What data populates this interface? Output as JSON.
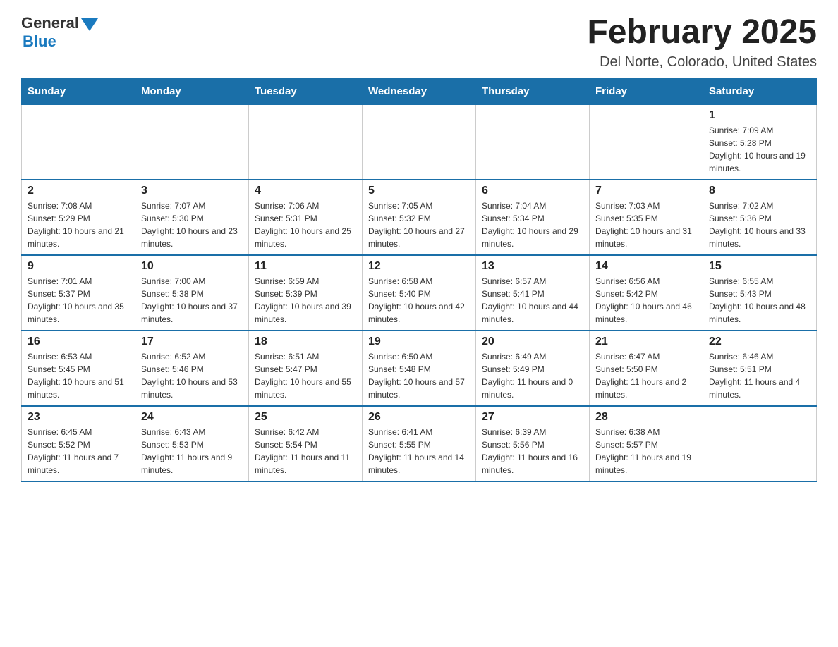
{
  "header": {
    "logo_general": "General",
    "logo_blue": "Blue",
    "title": "February 2025",
    "subtitle": "Del Norte, Colorado, United States"
  },
  "days_of_week": [
    "Sunday",
    "Monday",
    "Tuesday",
    "Wednesday",
    "Thursday",
    "Friday",
    "Saturday"
  ],
  "weeks": [
    [
      {
        "day": "",
        "info": ""
      },
      {
        "day": "",
        "info": ""
      },
      {
        "day": "",
        "info": ""
      },
      {
        "day": "",
        "info": ""
      },
      {
        "day": "",
        "info": ""
      },
      {
        "day": "",
        "info": ""
      },
      {
        "day": "1",
        "info": "Sunrise: 7:09 AM\nSunset: 5:28 PM\nDaylight: 10 hours and 19 minutes."
      }
    ],
    [
      {
        "day": "2",
        "info": "Sunrise: 7:08 AM\nSunset: 5:29 PM\nDaylight: 10 hours and 21 minutes."
      },
      {
        "day": "3",
        "info": "Sunrise: 7:07 AM\nSunset: 5:30 PM\nDaylight: 10 hours and 23 minutes."
      },
      {
        "day": "4",
        "info": "Sunrise: 7:06 AM\nSunset: 5:31 PM\nDaylight: 10 hours and 25 minutes."
      },
      {
        "day": "5",
        "info": "Sunrise: 7:05 AM\nSunset: 5:32 PM\nDaylight: 10 hours and 27 minutes."
      },
      {
        "day": "6",
        "info": "Sunrise: 7:04 AM\nSunset: 5:34 PM\nDaylight: 10 hours and 29 minutes."
      },
      {
        "day": "7",
        "info": "Sunrise: 7:03 AM\nSunset: 5:35 PM\nDaylight: 10 hours and 31 minutes."
      },
      {
        "day": "8",
        "info": "Sunrise: 7:02 AM\nSunset: 5:36 PM\nDaylight: 10 hours and 33 minutes."
      }
    ],
    [
      {
        "day": "9",
        "info": "Sunrise: 7:01 AM\nSunset: 5:37 PM\nDaylight: 10 hours and 35 minutes."
      },
      {
        "day": "10",
        "info": "Sunrise: 7:00 AM\nSunset: 5:38 PM\nDaylight: 10 hours and 37 minutes."
      },
      {
        "day": "11",
        "info": "Sunrise: 6:59 AM\nSunset: 5:39 PM\nDaylight: 10 hours and 39 minutes."
      },
      {
        "day": "12",
        "info": "Sunrise: 6:58 AM\nSunset: 5:40 PM\nDaylight: 10 hours and 42 minutes."
      },
      {
        "day": "13",
        "info": "Sunrise: 6:57 AM\nSunset: 5:41 PM\nDaylight: 10 hours and 44 minutes."
      },
      {
        "day": "14",
        "info": "Sunrise: 6:56 AM\nSunset: 5:42 PM\nDaylight: 10 hours and 46 minutes."
      },
      {
        "day": "15",
        "info": "Sunrise: 6:55 AM\nSunset: 5:43 PM\nDaylight: 10 hours and 48 minutes."
      }
    ],
    [
      {
        "day": "16",
        "info": "Sunrise: 6:53 AM\nSunset: 5:45 PM\nDaylight: 10 hours and 51 minutes."
      },
      {
        "day": "17",
        "info": "Sunrise: 6:52 AM\nSunset: 5:46 PM\nDaylight: 10 hours and 53 minutes."
      },
      {
        "day": "18",
        "info": "Sunrise: 6:51 AM\nSunset: 5:47 PM\nDaylight: 10 hours and 55 minutes."
      },
      {
        "day": "19",
        "info": "Sunrise: 6:50 AM\nSunset: 5:48 PM\nDaylight: 10 hours and 57 minutes."
      },
      {
        "day": "20",
        "info": "Sunrise: 6:49 AM\nSunset: 5:49 PM\nDaylight: 11 hours and 0 minutes."
      },
      {
        "day": "21",
        "info": "Sunrise: 6:47 AM\nSunset: 5:50 PM\nDaylight: 11 hours and 2 minutes."
      },
      {
        "day": "22",
        "info": "Sunrise: 6:46 AM\nSunset: 5:51 PM\nDaylight: 11 hours and 4 minutes."
      }
    ],
    [
      {
        "day": "23",
        "info": "Sunrise: 6:45 AM\nSunset: 5:52 PM\nDaylight: 11 hours and 7 minutes."
      },
      {
        "day": "24",
        "info": "Sunrise: 6:43 AM\nSunset: 5:53 PM\nDaylight: 11 hours and 9 minutes."
      },
      {
        "day": "25",
        "info": "Sunrise: 6:42 AM\nSunset: 5:54 PM\nDaylight: 11 hours and 11 minutes."
      },
      {
        "day": "26",
        "info": "Sunrise: 6:41 AM\nSunset: 5:55 PM\nDaylight: 11 hours and 14 minutes."
      },
      {
        "day": "27",
        "info": "Sunrise: 6:39 AM\nSunset: 5:56 PM\nDaylight: 11 hours and 16 minutes."
      },
      {
        "day": "28",
        "info": "Sunrise: 6:38 AM\nSunset: 5:57 PM\nDaylight: 11 hours and 19 minutes."
      },
      {
        "day": "",
        "info": ""
      }
    ]
  ]
}
